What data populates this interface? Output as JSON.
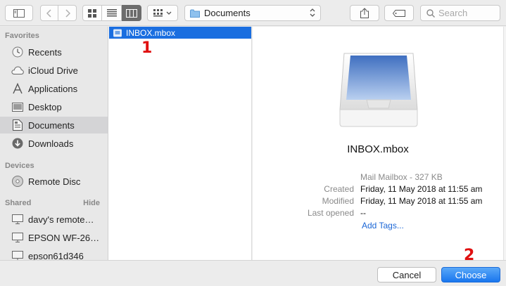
{
  "toolbar": {
    "location": "Documents",
    "search_placeholder": "Search"
  },
  "sidebar": {
    "favorites_heading": "Favorites",
    "favorites": [
      {
        "label": "Recents",
        "icon": "clock-icon"
      },
      {
        "label": "iCloud Drive",
        "icon": "cloud-icon"
      },
      {
        "label": "Applications",
        "icon": "applications-icon"
      },
      {
        "label": "Desktop",
        "icon": "desktop-icon"
      },
      {
        "label": "Documents",
        "icon": "document-icon",
        "selected": true
      },
      {
        "label": "Downloads",
        "icon": "download-icon"
      }
    ],
    "devices_heading": "Devices",
    "devices": [
      {
        "label": "Remote Disc",
        "icon": "disc-icon"
      }
    ],
    "shared_heading": "Shared",
    "shared_hide": "Hide",
    "shared": [
      {
        "label": "davy's remote…",
        "icon": "monitor-icon"
      },
      {
        "label": "EPSON WF-26…",
        "icon": "monitor-icon"
      },
      {
        "label": "epson61d346",
        "icon": "monitor-icon"
      }
    ]
  },
  "file_list": {
    "items": [
      {
        "name": "INBOX.mbox",
        "selected": true
      }
    ]
  },
  "preview": {
    "name": "INBOX.mbox",
    "kind": "Mail Mailbox - 327 KB",
    "created_label": "Created",
    "created_value": "Friday, 11 May 2018 at 11:55 am",
    "modified_label": "Modified",
    "modified_value": "Friday, 11 May 2018 at 11:55 am",
    "last_opened_label": "Last opened",
    "last_opened_value": "--",
    "add_tags": "Add Tags..."
  },
  "buttons": {
    "cancel": "Cancel",
    "choose": "Choose"
  },
  "annotations": {
    "first": "1",
    "second": "2",
    "color": "#e01010"
  },
  "colors": {
    "selection": "#1a6ee0",
    "accent": "#1976ee"
  }
}
